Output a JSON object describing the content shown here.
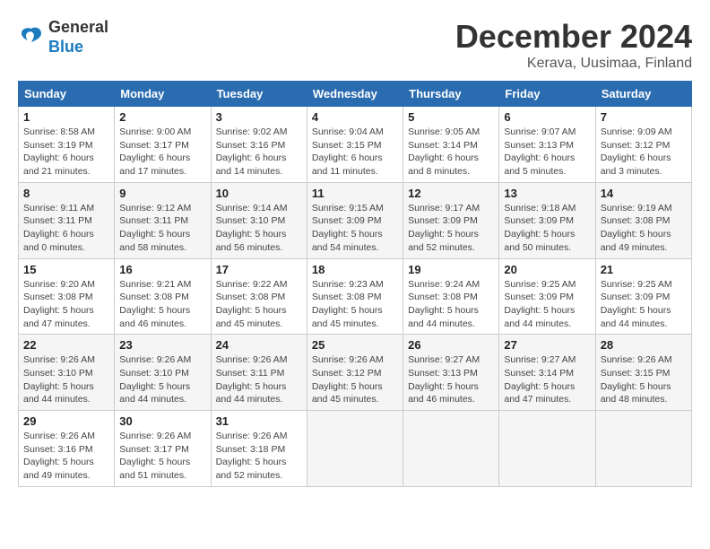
{
  "header": {
    "logo_line1": "General",
    "logo_line2": "Blue",
    "month": "December 2024",
    "location": "Kerava, Uusimaa, Finland"
  },
  "weekdays": [
    "Sunday",
    "Monday",
    "Tuesday",
    "Wednesday",
    "Thursday",
    "Friday",
    "Saturday"
  ],
  "weeks": [
    [
      {
        "day": "1",
        "sunrise": "Sunrise: 8:58 AM",
        "sunset": "Sunset: 3:19 PM",
        "daylight": "Daylight: 6 hours and 21 minutes."
      },
      {
        "day": "2",
        "sunrise": "Sunrise: 9:00 AM",
        "sunset": "Sunset: 3:17 PM",
        "daylight": "Daylight: 6 hours and 17 minutes."
      },
      {
        "day": "3",
        "sunrise": "Sunrise: 9:02 AM",
        "sunset": "Sunset: 3:16 PM",
        "daylight": "Daylight: 6 hours and 14 minutes."
      },
      {
        "day": "4",
        "sunrise": "Sunrise: 9:04 AM",
        "sunset": "Sunset: 3:15 PM",
        "daylight": "Daylight: 6 hours and 11 minutes."
      },
      {
        "day": "5",
        "sunrise": "Sunrise: 9:05 AM",
        "sunset": "Sunset: 3:14 PM",
        "daylight": "Daylight: 6 hours and 8 minutes."
      },
      {
        "day": "6",
        "sunrise": "Sunrise: 9:07 AM",
        "sunset": "Sunset: 3:13 PM",
        "daylight": "Daylight: 6 hours and 5 minutes."
      },
      {
        "day": "7",
        "sunrise": "Sunrise: 9:09 AM",
        "sunset": "Sunset: 3:12 PM",
        "daylight": "Daylight: 6 hours and 3 minutes."
      }
    ],
    [
      {
        "day": "8",
        "sunrise": "Sunrise: 9:11 AM",
        "sunset": "Sunset: 3:11 PM",
        "daylight": "Daylight: 6 hours and 0 minutes."
      },
      {
        "day": "9",
        "sunrise": "Sunrise: 9:12 AM",
        "sunset": "Sunset: 3:11 PM",
        "daylight": "Daylight: 5 hours and 58 minutes."
      },
      {
        "day": "10",
        "sunrise": "Sunrise: 9:14 AM",
        "sunset": "Sunset: 3:10 PM",
        "daylight": "Daylight: 5 hours and 56 minutes."
      },
      {
        "day": "11",
        "sunrise": "Sunrise: 9:15 AM",
        "sunset": "Sunset: 3:09 PM",
        "daylight": "Daylight: 5 hours and 54 minutes."
      },
      {
        "day": "12",
        "sunrise": "Sunrise: 9:17 AM",
        "sunset": "Sunset: 3:09 PM",
        "daylight": "Daylight: 5 hours and 52 minutes."
      },
      {
        "day": "13",
        "sunrise": "Sunrise: 9:18 AM",
        "sunset": "Sunset: 3:09 PM",
        "daylight": "Daylight: 5 hours and 50 minutes."
      },
      {
        "day": "14",
        "sunrise": "Sunrise: 9:19 AM",
        "sunset": "Sunset: 3:08 PM",
        "daylight": "Daylight: 5 hours and 49 minutes."
      }
    ],
    [
      {
        "day": "15",
        "sunrise": "Sunrise: 9:20 AM",
        "sunset": "Sunset: 3:08 PM",
        "daylight": "Daylight: 5 hours and 47 minutes."
      },
      {
        "day": "16",
        "sunrise": "Sunrise: 9:21 AM",
        "sunset": "Sunset: 3:08 PM",
        "daylight": "Daylight: 5 hours and 46 minutes."
      },
      {
        "day": "17",
        "sunrise": "Sunrise: 9:22 AM",
        "sunset": "Sunset: 3:08 PM",
        "daylight": "Daylight: 5 hours and 45 minutes."
      },
      {
        "day": "18",
        "sunrise": "Sunrise: 9:23 AM",
        "sunset": "Sunset: 3:08 PM",
        "daylight": "Daylight: 5 hours and 45 minutes."
      },
      {
        "day": "19",
        "sunrise": "Sunrise: 9:24 AM",
        "sunset": "Sunset: 3:08 PM",
        "daylight": "Daylight: 5 hours and 44 minutes."
      },
      {
        "day": "20",
        "sunrise": "Sunrise: 9:25 AM",
        "sunset": "Sunset: 3:09 PM",
        "daylight": "Daylight: 5 hours and 44 minutes."
      },
      {
        "day": "21",
        "sunrise": "Sunrise: 9:25 AM",
        "sunset": "Sunset: 3:09 PM",
        "daylight": "Daylight: 5 hours and 44 minutes."
      }
    ],
    [
      {
        "day": "22",
        "sunrise": "Sunrise: 9:26 AM",
        "sunset": "Sunset: 3:10 PM",
        "daylight": "Daylight: 5 hours and 44 minutes."
      },
      {
        "day": "23",
        "sunrise": "Sunrise: 9:26 AM",
        "sunset": "Sunset: 3:10 PM",
        "daylight": "Daylight: 5 hours and 44 minutes."
      },
      {
        "day": "24",
        "sunrise": "Sunrise: 9:26 AM",
        "sunset": "Sunset: 3:11 PM",
        "daylight": "Daylight: 5 hours and 44 minutes."
      },
      {
        "day": "25",
        "sunrise": "Sunrise: 9:26 AM",
        "sunset": "Sunset: 3:12 PM",
        "daylight": "Daylight: 5 hours and 45 minutes."
      },
      {
        "day": "26",
        "sunrise": "Sunrise: 9:27 AM",
        "sunset": "Sunset: 3:13 PM",
        "daylight": "Daylight: 5 hours and 46 minutes."
      },
      {
        "day": "27",
        "sunrise": "Sunrise: 9:27 AM",
        "sunset": "Sunset: 3:14 PM",
        "daylight": "Daylight: 5 hours and 47 minutes."
      },
      {
        "day": "28",
        "sunrise": "Sunrise: 9:26 AM",
        "sunset": "Sunset: 3:15 PM",
        "daylight": "Daylight: 5 hours and 48 minutes."
      }
    ],
    [
      {
        "day": "29",
        "sunrise": "Sunrise: 9:26 AM",
        "sunset": "Sunset: 3:16 PM",
        "daylight": "Daylight: 5 hours and 49 minutes."
      },
      {
        "day": "30",
        "sunrise": "Sunrise: 9:26 AM",
        "sunset": "Sunset: 3:17 PM",
        "daylight": "Daylight: 5 hours and 51 minutes."
      },
      {
        "day": "31",
        "sunrise": "Sunrise: 9:26 AM",
        "sunset": "Sunset: 3:18 PM",
        "daylight": "Daylight: 5 hours and 52 minutes."
      },
      null,
      null,
      null,
      null
    ]
  ]
}
